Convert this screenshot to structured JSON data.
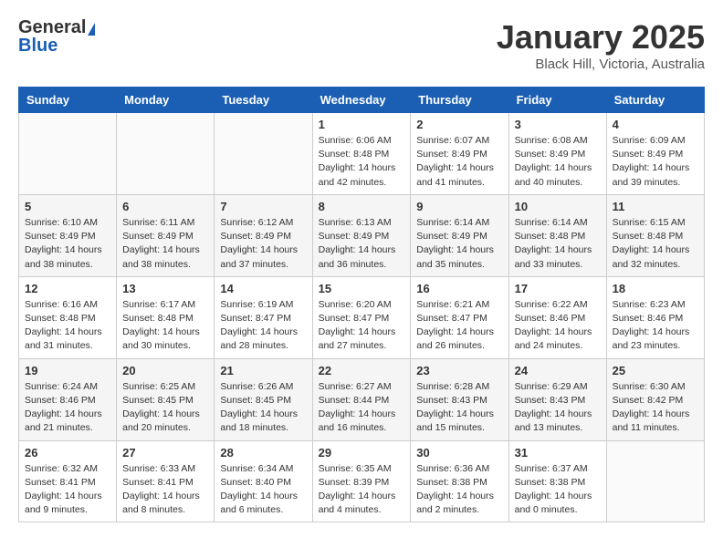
{
  "logo": {
    "general": "General",
    "blue": "Blue"
  },
  "title": "January 2025",
  "location": "Black Hill, Victoria, Australia",
  "weekdays": [
    "Sunday",
    "Monday",
    "Tuesday",
    "Wednesday",
    "Thursday",
    "Friday",
    "Saturday"
  ],
  "weeks": [
    [
      {
        "day": "",
        "sunrise": "",
        "sunset": "",
        "daylight": ""
      },
      {
        "day": "",
        "sunrise": "",
        "sunset": "",
        "daylight": ""
      },
      {
        "day": "",
        "sunrise": "",
        "sunset": "",
        "daylight": ""
      },
      {
        "day": "1",
        "sunrise": "Sunrise: 6:06 AM",
        "sunset": "Sunset: 8:48 PM",
        "daylight": "Daylight: 14 hours and 42 minutes."
      },
      {
        "day": "2",
        "sunrise": "Sunrise: 6:07 AM",
        "sunset": "Sunset: 8:49 PM",
        "daylight": "Daylight: 14 hours and 41 minutes."
      },
      {
        "day": "3",
        "sunrise": "Sunrise: 6:08 AM",
        "sunset": "Sunset: 8:49 PM",
        "daylight": "Daylight: 14 hours and 40 minutes."
      },
      {
        "day": "4",
        "sunrise": "Sunrise: 6:09 AM",
        "sunset": "Sunset: 8:49 PM",
        "daylight": "Daylight: 14 hours and 39 minutes."
      }
    ],
    [
      {
        "day": "5",
        "sunrise": "Sunrise: 6:10 AM",
        "sunset": "Sunset: 8:49 PM",
        "daylight": "Daylight: 14 hours and 38 minutes."
      },
      {
        "day": "6",
        "sunrise": "Sunrise: 6:11 AM",
        "sunset": "Sunset: 8:49 PM",
        "daylight": "Daylight: 14 hours and 38 minutes."
      },
      {
        "day": "7",
        "sunrise": "Sunrise: 6:12 AM",
        "sunset": "Sunset: 8:49 PM",
        "daylight": "Daylight: 14 hours and 37 minutes."
      },
      {
        "day": "8",
        "sunrise": "Sunrise: 6:13 AM",
        "sunset": "Sunset: 8:49 PM",
        "daylight": "Daylight: 14 hours and 36 minutes."
      },
      {
        "day": "9",
        "sunrise": "Sunrise: 6:14 AM",
        "sunset": "Sunset: 8:49 PM",
        "daylight": "Daylight: 14 hours and 35 minutes."
      },
      {
        "day": "10",
        "sunrise": "Sunrise: 6:14 AM",
        "sunset": "Sunset: 8:48 PM",
        "daylight": "Daylight: 14 hours and 33 minutes."
      },
      {
        "day": "11",
        "sunrise": "Sunrise: 6:15 AM",
        "sunset": "Sunset: 8:48 PM",
        "daylight": "Daylight: 14 hours and 32 minutes."
      }
    ],
    [
      {
        "day": "12",
        "sunrise": "Sunrise: 6:16 AM",
        "sunset": "Sunset: 8:48 PM",
        "daylight": "Daylight: 14 hours and 31 minutes."
      },
      {
        "day": "13",
        "sunrise": "Sunrise: 6:17 AM",
        "sunset": "Sunset: 8:48 PM",
        "daylight": "Daylight: 14 hours and 30 minutes."
      },
      {
        "day": "14",
        "sunrise": "Sunrise: 6:19 AM",
        "sunset": "Sunset: 8:47 PM",
        "daylight": "Daylight: 14 hours and 28 minutes."
      },
      {
        "day": "15",
        "sunrise": "Sunrise: 6:20 AM",
        "sunset": "Sunset: 8:47 PM",
        "daylight": "Daylight: 14 hours and 27 minutes."
      },
      {
        "day": "16",
        "sunrise": "Sunrise: 6:21 AM",
        "sunset": "Sunset: 8:47 PM",
        "daylight": "Daylight: 14 hours and 26 minutes."
      },
      {
        "day": "17",
        "sunrise": "Sunrise: 6:22 AM",
        "sunset": "Sunset: 8:46 PM",
        "daylight": "Daylight: 14 hours and 24 minutes."
      },
      {
        "day": "18",
        "sunrise": "Sunrise: 6:23 AM",
        "sunset": "Sunset: 8:46 PM",
        "daylight": "Daylight: 14 hours and 23 minutes."
      }
    ],
    [
      {
        "day": "19",
        "sunrise": "Sunrise: 6:24 AM",
        "sunset": "Sunset: 8:46 PM",
        "daylight": "Daylight: 14 hours and 21 minutes."
      },
      {
        "day": "20",
        "sunrise": "Sunrise: 6:25 AM",
        "sunset": "Sunset: 8:45 PM",
        "daylight": "Daylight: 14 hours and 20 minutes."
      },
      {
        "day": "21",
        "sunrise": "Sunrise: 6:26 AM",
        "sunset": "Sunset: 8:45 PM",
        "daylight": "Daylight: 14 hours and 18 minutes."
      },
      {
        "day": "22",
        "sunrise": "Sunrise: 6:27 AM",
        "sunset": "Sunset: 8:44 PM",
        "daylight": "Daylight: 14 hours and 16 minutes."
      },
      {
        "day": "23",
        "sunrise": "Sunrise: 6:28 AM",
        "sunset": "Sunset: 8:43 PM",
        "daylight": "Daylight: 14 hours and 15 minutes."
      },
      {
        "day": "24",
        "sunrise": "Sunrise: 6:29 AM",
        "sunset": "Sunset: 8:43 PM",
        "daylight": "Daylight: 14 hours and 13 minutes."
      },
      {
        "day": "25",
        "sunrise": "Sunrise: 6:30 AM",
        "sunset": "Sunset: 8:42 PM",
        "daylight": "Daylight: 14 hours and 11 minutes."
      }
    ],
    [
      {
        "day": "26",
        "sunrise": "Sunrise: 6:32 AM",
        "sunset": "Sunset: 8:41 PM",
        "daylight": "Daylight: 14 hours and 9 minutes."
      },
      {
        "day": "27",
        "sunrise": "Sunrise: 6:33 AM",
        "sunset": "Sunset: 8:41 PM",
        "daylight": "Daylight: 14 hours and 8 minutes."
      },
      {
        "day": "28",
        "sunrise": "Sunrise: 6:34 AM",
        "sunset": "Sunset: 8:40 PM",
        "daylight": "Daylight: 14 hours and 6 minutes."
      },
      {
        "day": "29",
        "sunrise": "Sunrise: 6:35 AM",
        "sunset": "Sunset: 8:39 PM",
        "daylight": "Daylight: 14 hours and 4 minutes."
      },
      {
        "day": "30",
        "sunrise": "Sunrise: 6:36 AM",
        "sunset": "Sunset: 8:38 PM",
        "daylight": "Daylight: 14 hours and 2 minutes."
      },
      {
        "day": "31",
        "sunrise": "Sunrise: 6:37 AM",
        "sunset": "Sunset: 8:38 PM",
        "daylight": "Daylight: 14 hours and 0 minutes."
      },
      {
        "day": "",
        "sunrise": "",
        "sunset": "",
        "daylight": ""
      }
    ]
  ]
}
